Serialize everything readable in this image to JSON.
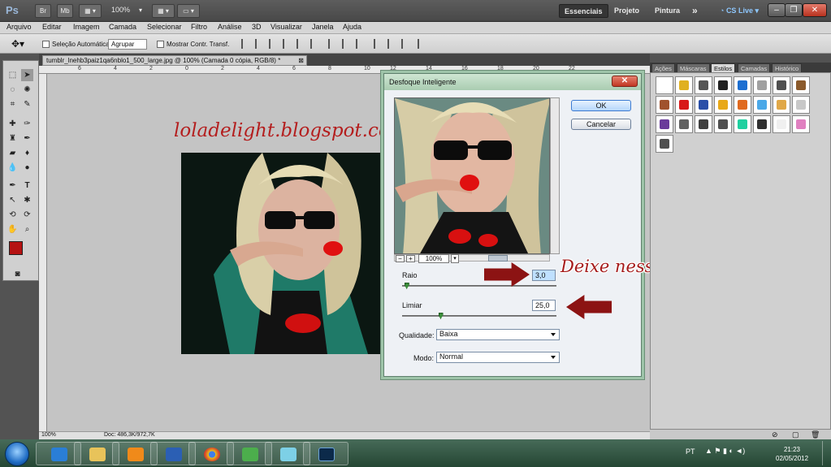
{
  "app": {
    "logo": "Ps",
    "buttons": [
      "Br",
      "Mb"
    ],
    "zoom": "100%",
    "workspaces": [
      "Essenciais",
      "Projeto",
      "Pintura"
    ],
    "more": "»",
    "cslive": "CS Live"
  },
  "menu": [
    "Arquivo",
    "Editar",
    "Imagem",
    "Camada",
    "Selecionar",
    "Filtro",
    "Análise",
    "3D",
    "Visualizar",
    "Janela",
    "Ajuda"
  ],
  "options": {
    "auto_select": "Seleção Automática:",
    "auto_select_value": "Agrupar",
    "show_transform": "Mostrar Contr. Transf."
  },
  "document": {
    "tab_title": "tumblr_lnehb3paiz1qa6nblo1_500_large.jpg @ 100% (Camada 0 cópia, RGB/8) *",
    "ruler_ticks": [
      "6",
      "4",
      "2",
      "0",
      "2",
      "4",
      "6",
      "8",
      "10",
      "12",
      "14",
      "16",
      "18",
      "20",
      "22"
    ],
    "watermark": "loladelight.blogspot.com",
    "status_zoom": "100%",
    "status_doc": "Doc: 486,3K/972,7K"
  },
  "dialog": {
    "title": "Desfoque Inteligente",
    "ok": "OK",
    "cancel": "Cancelar",
    "preview_zoom": "100%",
    "radius_label": "Raio",
    "radius_value": "3,0",
    "threshold_label": "Limiar",
    "threshold_value": "25,0",
    "quality_label": "Qualidade:",
    "quality_value": "Baixa",
    "mode_label": "Modo:",
    "mode_value": "Normal",
    "radius_slider_fraction": 0.03,
    "threshold_slider_fraction": 0.25
  },
  "annotation": {
    "text": "Deixe nessas proporções",
    "color": "#8c1313"
  },
  "panels": {
    "tabs": [
      "Ações",
      "Máscaras",
      "Estilos",
      "Camadas",
      "Histórico"
    ],
    "active_tab": "Estilos",
    "swatches": [
      "#ffffff",
      "#e0b020",
      "#555555",
      "#222222",
      "#1d6fd1",
      "#a0a0a0",
      "#505050",
      "#8b5a2b",
      "#a0522d",
      "#d81818",
      "#2a4fa8",
      "#e8a818",
      "#e06a20",
      "#4aa8e8",
      "#e0a848",
      "#c8c8c8",
      "#6a3a9a",
      "#606060",
      "#404040",
      "#505050",
      "#20d0a0",
      "#303030",
      "#f0f0f0",
      "#e080c0",
      "#505050"
    ]
  },
  "taskbar": {
    "lang": "PT",
    "time": "21:23",
    "date": "02/05/2012",
    "apps": [
      "ie",
      "explorer",
      "media-player",
      "word",
      "chrome",
      "messenger",
      "app",
      "photoshop"
    ]
  }
}
